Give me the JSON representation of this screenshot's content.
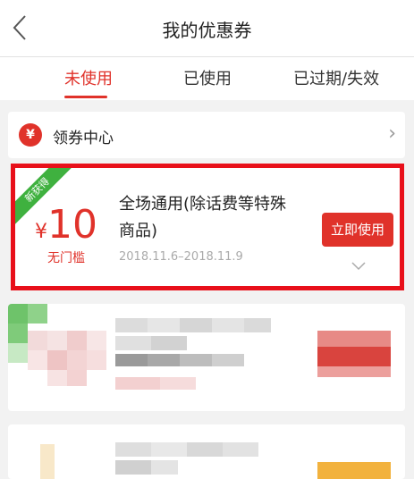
{
  "header": {
    "title": "我的优惠券"
  },
  "tabs": [
    {
      "label": "未使用",
      "active": true
    },
    {
      "label": "已使用",
      "active": false
    },
    {
      "label": "已过期/失效",
      "active": false
    }
  ],
  "coupon_center": {
    "icon_glyph": "¥",
    "label": "领券中心"
  },
  "coupon": {
    "ribbon": "新获得",
    "currency": "¥",
    "amount": "10",
    "threshold": "无门槛",
    "title": "全场通用(除话费等特殊商品)",
    "validity": "2018.11.6–2018.11.9",
    "use_button": "立即使用"
  },
  "colors": {
    "accent": "#e0322a",
    "highlight_border": "#e8101a",
    "ribbon": "#3fb13f"
  }
}
